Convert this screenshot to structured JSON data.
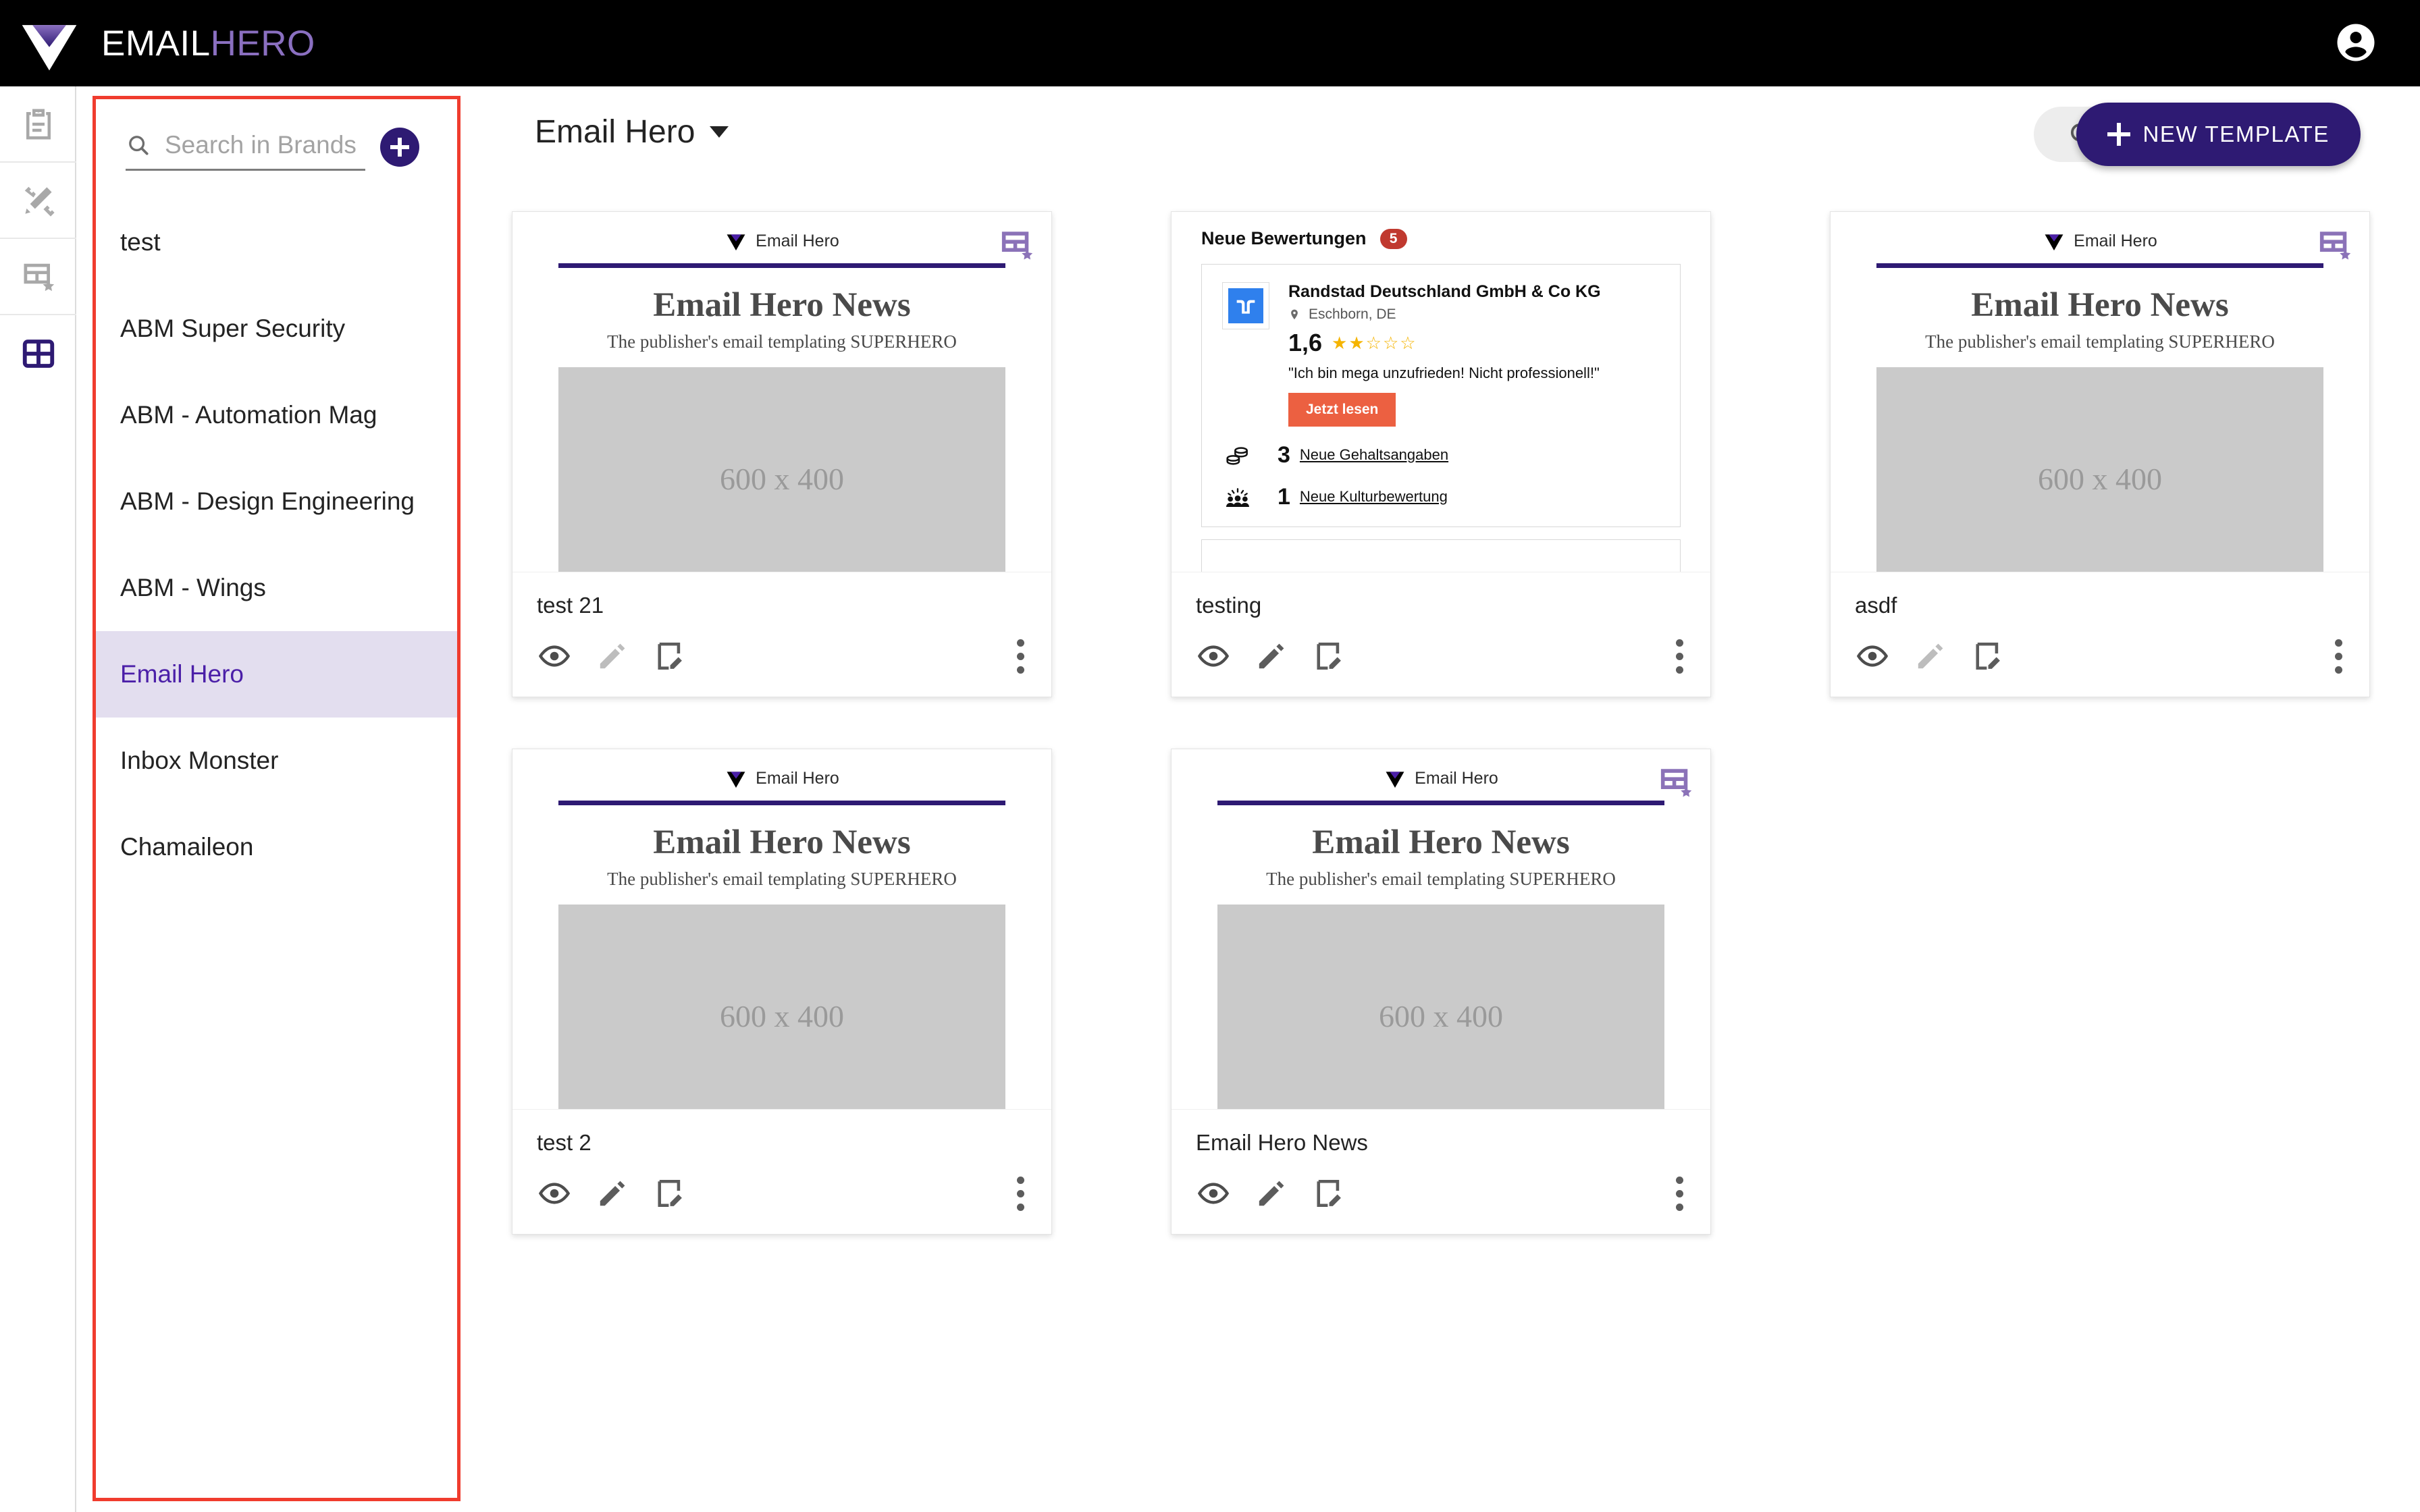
{
  "header": {
    "brand_word_1": "EMAIL",
    "brand_word_2": "HERO",
    "logo_icon": "diamond-logo-icon",
    "account_icon": "account-circle-icon"
  },
  "rail": {
    "items": [
      {
        "icon": "clipboard-icon",
        "active": false
      },
      {
        "icon": "magic-wand-pencil-icon",
        "active": false
      },
      {
        "icon": "layout-star-icon",
        "active": false
      },
      {
        "icon": "grid-table-icon",
        "active": true
      }
    ],
    "active_color": "#2e1a73",
    "inactive_color": "#a8a8a8"
  },
  "sidebar": {
    "highlight_color": "#f03c2e",
    "search": {
      "placeholder": "Search in Brands",
      "value": "",
      "icon": "search-icon"
    },
    "add_button": {
      "icon": "plus-icon",
      "color": "#2e1a73"
    },
    "selected": "Email Hero",
    "items": [
      {
        "label": "test"
      },
      {
        "label": "ABM Super Security"
      },
      {
        "label": "ABM - Automation Mag"
      },
      {
        "label": "ABM - Design Engineering"
      },
      {
        "label": "ABM - Wings"
      },
      {
        "label": "Email Hero"
      },
      {
        "label": "Inbox Monster"
      },
      {
        "label": "Chamaileon"
      }
    ]
  },
  "main": {
    "page_title": "Email Hero",
    "title_caret_icon": "chevron-down-icon",
    "search_button": {
      "icon": "search-icon"
    },
    "new_template_button": {
      "label": "NEW TEMPLATE",
      "icon": "plus-icon",
      "color": "#2e1a73"
    }
  },
  "news_template": {
    "logo_label": "Email Hero",
    "title": "Email Hero News",
    "subtitle": "The publisher's email templating SUPERHERO",
    "image_placeholder": "600 x 400",
    "rule_color": "#2e1a73"
  },
  "review_template": {
    "heading": "Neue Bewertungen",
    "count": "5",
    "company": "Randstad Deutschland GmbH & Co KG",
    "location": "Eschborn, DE",
    "score": "1,6",
    "stars": "★★☆☆☆",
    "quote": "\"Ich bin mega unzufrieden! Nicht professionell!\"",
    "cta": "Jetzt lesen",
    "stats": [
      {
        "icon": "coins-icon",
        "number": "3",
        "label": "Neue Gehaltsangaben"
      },
      {
        "icon": "people-icon",
        "number": "1",
        "label": "Neue Kulturbewertung"
      }
    ],
    "cta_color": "#ec6041",
    "badge_color": "#c0392f"
  },
  "cards": [
    {
      "name": "test 21",
      "type": "news",
      "badge": true,
      "edit_enabled": false
    },
    {
      "name": "testing",
      "type": "review",
      "badge": false,
      "edit_enabled": true
    },
    {
      "name": "asdf",
      "type": "news",
      "badge": true,
      "edit_enabled": false
    },
    {
      "name": "test 2",
      "type": "news",
      "badge": false,
      "edit_enabled": true
    },
    {
      "name": "Email Hero News",
      "type": "news",
      "badge": true,
      "edit_enabled": true
    }
  ],
  "card_actions": {
    "preview_icon": "eye-icon",
    "edit_icon": "pencil-icon",
    "rename_icon": "note-edit-icon",
    "menu_icon": "kebab-menu-icon"
  }
}
